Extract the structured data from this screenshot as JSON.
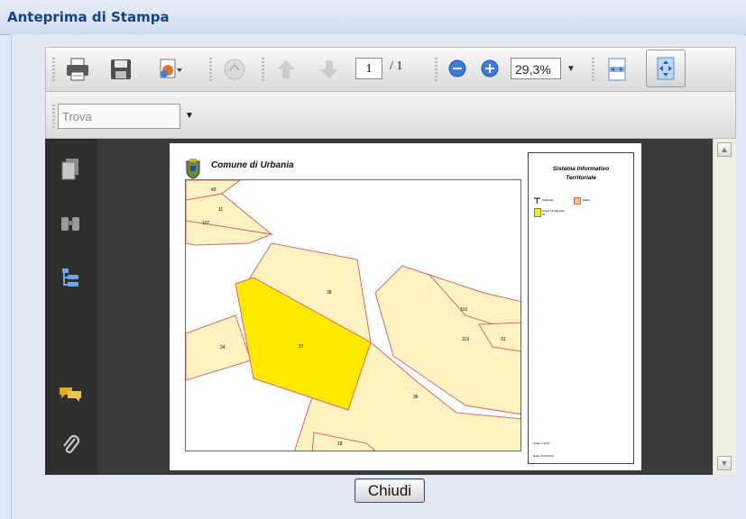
{
  "window": {
    "title": "Anteprima di Stampa"
  },
  "toolbar": {
    "page_current": "1",
    "page_total": "/ 1",
    "zoom": "29,3%",
    "icons": [
      "print-icon",
      "save-icon",
      "export-icon",
      "hand-icon",
      "prev-page-icon",
      "next-page-icon",
      "zoom-out-icon",
      "zoom-in-icon",
      "fit-width-icon",
      "fit-page-icon"
    ]
  },
  "find": {
    "placeholder": "Trova"
  },
  "sidebar": {
    "icons": [
      "pages-icon",
      "find-binoculars-icon",
      "bookmarks-icon",
      "comments-icon",
      "attachments-icon"
    ]
  },
  "document": {
    "title": "Comune di Urbania",
    "panel_title_1": "Sistema Informativo",
    "panel_title_2": "Territoriale",
    "legend": [
      {
        "label": "Particelle"
      },
      {
        "label": "Edifici"
      },
      {
        "label": "Foglio 14 Mappale 37"
      }
    ],
    "scale": "Scala: 1:1247",
    "date": "Data: 27/11/2014",
    "parcels": [
      {
        "label": "43"
      },
      {
        "label": "11"
      },
      {
        "label": "107"
      },
      {
        "label": "38"
      },
      {
        "label": "37"
      },
      {
        "label": "24"
      },
      {
        "label": "110"
      },
      {
        "label": "119"
      },
      {
        "label": "31"
      },
      {
        "label": "36"
      },
      {
        "label": "18"
      }
    ]
  },
  "buttons": {
    "close": "Chiudi"
  },
  "colors": {
    "parcel_fill": "#fff3c2",
    "parcel_border": "#d9686a",
    "selected_parcel": "#ffea00",
    "accent": "#15428b"
  }
}
